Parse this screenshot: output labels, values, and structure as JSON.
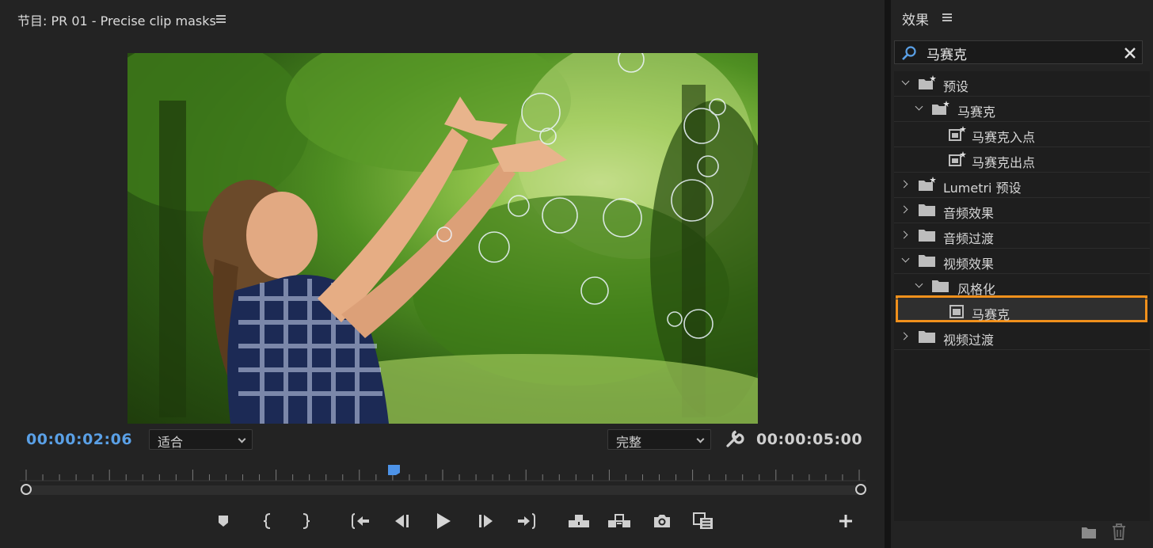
{
  "monitor": {
    "title": "节目: PR 01 - Precise clip masks",
    "timecode_current": "00:00:02:06",
    "fit_dropdown": "适合",
    "quality_dropdown": "完整",
    "timecode_duration": "00:00:05:00",
    "playhead_position": 0.44,
    "transport": [
      "marker-icon",
      "mark-in-icon",
      "mark-out-icon",
      "go-to-in-icon",
      "step-back-icon",
      "play-icon",
      "step-forward-icon",
      "go-to-out-icon",
      "lift-icon",
      "extract-icon",
      "export-frame-icon",
      "comparison-view-icon",
      "add-button-icon"
    ]
  },
  "effects": {
    "title": "效果",
    "search_value": "马赛克",
    "tree": [
      {
        "label": "预设",
        "icon": "preset-folder-icon",
        "expanded": true
      },
      {
        "label": "马赛克",
        "icon": "preset-folder-icon",
        "expanded": true
      },
      {
        "label": "马赛克入点",
        "icon": "preset-effect-icon"
      },
      {
        "label": "马赛克出点",
        "icon": "preset-effect-icon"
      },
      {
        "label": "Lumetri 预设",
        "icon": "preset-folder-icon",
        "expanded": false
      },
      {
        "label": "音频效果",
        "icon": "folder-icon",
        "expanded": false
      },
      {
        "label": "音频过渡",
        "icon": "folder-icon",
        "expanded": false
      },
      {
        "label": "视频效果",
        "icon": "folder-icon",
        "expanded": true
      },
      {
        "label": "风格化",
        "icon": "folder-icon",
        "expanded": true
      },
      {
        "label": "马赛克",
        "icon": "effect-icon",
        "selected": true
      },
      {
        "label": "视频过渡",
        "icon": "folder-icon",
        "expanded": false
      }
    ],
    "highlight_color": "#f0901c"
  },
  "colors": {
    "timecode_accent": "#5aa0e6",
    "panel_bg": "#232323"
  }
}
